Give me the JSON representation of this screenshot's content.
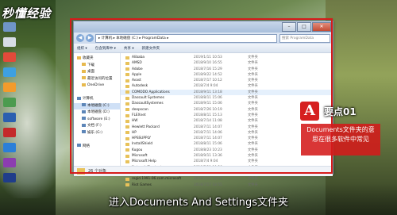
{
  "logo": "秒懂经验",
  "window": {
    "address": "▸ 计算机 ▸ 本地磁盘 (C:) ▸ ProgramData ▸",
    "search_placeholder": "搜索 ProgramData",
    "toolbar": [
      "组织 ▾",
      "包含到库中 ▾",
      "共享 ▾",
      "新建文件夹"
    ],
    "nav": [
      {
        "label": "收藏夹",
        "sub": false,
        "icon": "star-icon"
      },
      {
        "label": "下载",
        "sub": true,
        "icon": "folder-icon"
      },
      {
        "label": "桌面",
        "sub": true,
        "icon": "folder-icon"
      },
      {
        "label": "最近访问的位置",
        "sub": true,
        "icon": "folder-icon"
      },
      {
        "label": "OneDrive",
        "sub": true,
        "icon": "cloud-icon"
      },
      {
        "label": "",
        "sub": false,
        "icon": ""
      },
      {
        "label": "计算机",
        "sub": false,
        "icon": "computer-icon"
      },
      {
        "label": "本地磁盘 (C:)",
        "sub": true,
        "icon": "drive-icon",
        "selected": true
      },
      {
        "label": "本地磁盘 (D:)",
        "sub": true,
        "icon": "drive-icon"
      },
      {
        "label": "software (E:)",
        "sub": true,
        "icon": "drive-icon"
      },
      {
        "label": "文档 (F:)",
        "sub": true,
        "icon": "drive-icon"
      },
      {
        "label": "娱乐 (G:)",
        "sub": true,
        "icon": "drive-icon"
      },
      {
        "label": "",
        "sub": false,
        "icon": ""
      },
      {
        "label": "网络",
        "sub": false,
        "icon": "network-icon"
      }
    ],
    "files": [
      {
        "name": "Alibaba",
        "date": "2019/1/11 10:53",
        "type": "文件夹"
      },
      {
        "name": "AMSD",
        "date": "2018/9/10 16:55",
        "type": "文件夹"
      },
      {
        "name": "Adobe",
        "date": "2018/7/16 15:29",
        "type": "文件夹"
      },
      {
        "name": "Apple",
        "date": "2018/9/22 14:52",
        "type": "文件夹"
      },
      {
        "name": "Avast",
        "date": "2018/7/17 10:12",
        "type": "文件夹"
      },
      {
        "name": "Autodesk",
        "date": "2018/7/4 9:04",
        "type": "文件夹"
      },
      {
        "name": "COMODO Applications",
        "date": "2018/9/11 13:18",
        "type": "文件夹",
        "highlight": true
      },
      {
        "name": "Dassault Systemes",
        "date": "2018/8/11 15:06",
        "type": "文件夹"
      },
      {
        "name": "DassaultSystemes",
        "date": "2018/9/11 15:06",
        "type": "文件夹"
      },
      {
        "name": "deepscan",
        "date": "2018/7/26 10:19",
        "type": "文件夹"
      },
      {
        "name": "FLEXnet",
        "date": "2018/8/11 15:13",
        "type": "文件夹"
      },
      {
        "name": "HW",
        "date": "2018/7/14 11:08",
        "type": "文件夹"
      },
      {
        "name": "Hewlett Packard",
        "date": "2018/7/11 14:07",
        "type": "文件夹"
      },
      {
        "name": "HP",
        "date": "2018/7/11 14:06",
        "type": "文件夹"
      },
      {
        "name": "HPSSUPPLY",
        "date": "2018/7/11 14:07",
        "type": "文件夹"
      },
      {
        "name": "InstallShield",
        "date": "2018/8/11 15:06",
        "type": "文件夹"
      },
      {
        "name": "Kugou",
        "date": "2018/8/23 10:23",
        "type": "文件夹"
      },
      {
        "name": "Microsoft",
        "date": "2018/9/11 13:36",
        "type": "文件夹"
      },
      {
        "name": "Microsoft Help",
        "date": "2018/7/4 9:04",
        "type": "文件夹"
      },
      {
        "name": "Network Shortcuts",
        "date": "2018/7/11 10:26",
        "type": "文件夹"
      },
      {
        "name": "Package Cache",
        "date": "2018/7/11 14:01",
        "type": "文件夹"
      },
      {
        "name": "regid.1991-06.com.microsoft",
        "date": "2018/7/11 14:53",
        "type": "文件夹"
      },
      {
        "name": "Riot Games",
        "date": "2018/7/17 18:55",
        "type": "文件夹"
      }
    ],
    "status": "26 个对象"
  },
  "callout": {
    "logo_letter": "A",
    "title": "要点01",
    "body": "Documents文件夹的意思在很多软件中常见"
  },
  "subtitle": "进入Documents And Settings文件夹",
  "colors": {
    "accent_red": "#d61b1b",
    "folder": "#e8c25a"
  }
}
